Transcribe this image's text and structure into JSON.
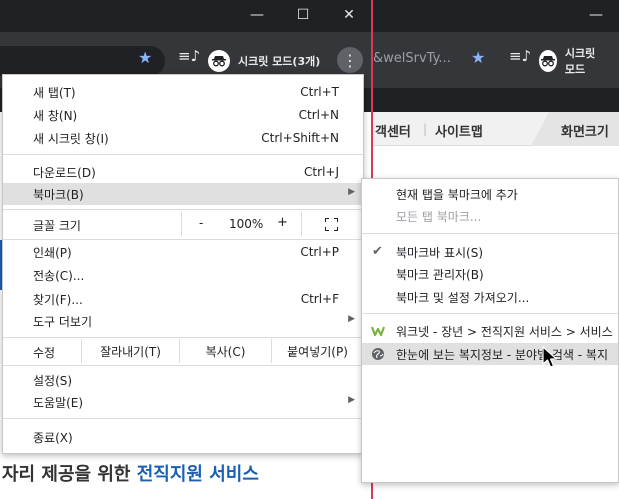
{
  "window_left": {
    "controls": {
      "minimize": "—",
      "maximize": "☐",
      "close": "✕"
    },
    "incognito_label": "시크릿 모드(3개)"
  },
  "window_right": {
    "url_fragment": "&welSrvTy...",
    "incognito_label": "시크릿 모드"
  },
  "page": {
    "nav": {
      "customer_center": "객센터",
      "sitemap": "사이트맵",
      "zoom_tab": "화면크기"
    },
    "heading_prefix": "자리 제공을 위한 ",
    "heading_highlight": "전직지원 서비스"
  },
  "main_menu": {
    "new_tab": {
      "label": "새 탭(T)",
      "shortcut": "Ctrl+T"
    },
    "new_window": {
      "label": "새 창(N)",
      "shortcut": "Ctrl+N"
    },
    "new_incognito": {
      "label": "새 시크릿 창(I)",
      "shortcut": "Ctrl+Shift+N"
    },
    "downloads": {
      "label": "다운로드(D)",
      "shortcut": "Ctrl+J"
    },
    "bookmarks": {
      "label": "북마크(B)"
    },
    "zoom": {
      "label": "글꼴 크기",
      "minus": "-",
      "value": "100%",
      "plus": "+"
    },
    "print": {
      "label": "인쇄(P)",
      "shortcut": "Ctrl+P"
    },
    "cast": {
      "label": "전송(C)..."
    },
    "find": {
      "label": "찾기(F)...",
      "shortcut": "Ctrl+F"
    },
    "more_tools": {
      "label": "도구 더보기"
    },
    "edit": {
      "label": "수정",
      "cut": "잘라내기(T)",
      "copy": "복사(C)",
      "paste": "붙여넣기(P)"
    },
    "settings": {
      "label": "설정(S)"
    },
    "help": {
      "label": "도움말(E)"
    },
    "exit": {
      "label": "종료(X)"
    }
  },
  "bookmarks_submenu": {
    "add_current": "현재 탭을 북마크에 추가",
    "bookmark_all": "모든 탭 북마크...",
    "show_bar": "북마크바 표시(S)",
    "manager": "북마크 관리자(B)",
    "import": "북마크 및 설정 가져오기...",
    "item_1": "워크넷 - 장년 > 전직지원 서비스 > 서비스",
    "item_2": "한눈에 보는 복지정보 - 분야별 검색 - 복지"
  },
  "colors": {
    "titlebar": "#202124",
    "toolbar": "#35363a",
    "accent_blue": "#1a5fb4",
    "menu_hover": "#e0e0e0",
    "window_border": "#d93a5a"
  }
}
